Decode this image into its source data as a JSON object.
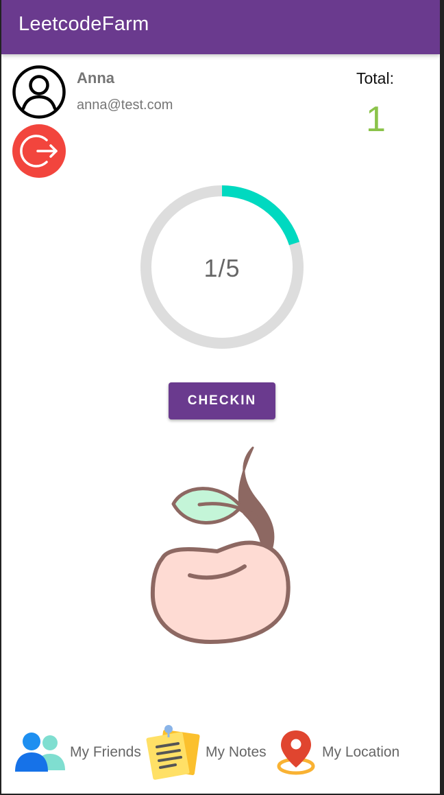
{
  "app": {
    "title": "LeetcodeFarm"
  },
  "user": {
    "name": "Anna",
    "email": "anna@test.com",
    "avatar_icon": "person-circle-icon",
    "logout_icon": "logout-icon"
  },
  "stats": {
    "total_label": "Total:",
    "total_value": "1"
  },
  "progress": {
    "text": "1/5",
    "current": 1,
    "goal": 5,
    "fraction": 0.2,
    "track_color": "#dddddd",
    "fill_color": "#00d9c0"
  },
  "actions": {
    "checkin_label": "CHECKIN"
  },
  "illustration": {
    "icon": "sprouting-bean-icon"
  },
  "nav": {
    "items": [
      {
        "label": "My Friends",
        "icon": "friends-icon"
      },
      {
        "label": "My Notes",
        "icon": "notes-icon"
      },
      {
        "label": "My Location",
        "icon": "location-pin-icon"
      }
    ]
  },
  "colors": {
    "primary": "#6a3a8e",
    "danger": "#f2453d",
    "total_green": "#8bc34a"
  }
}
